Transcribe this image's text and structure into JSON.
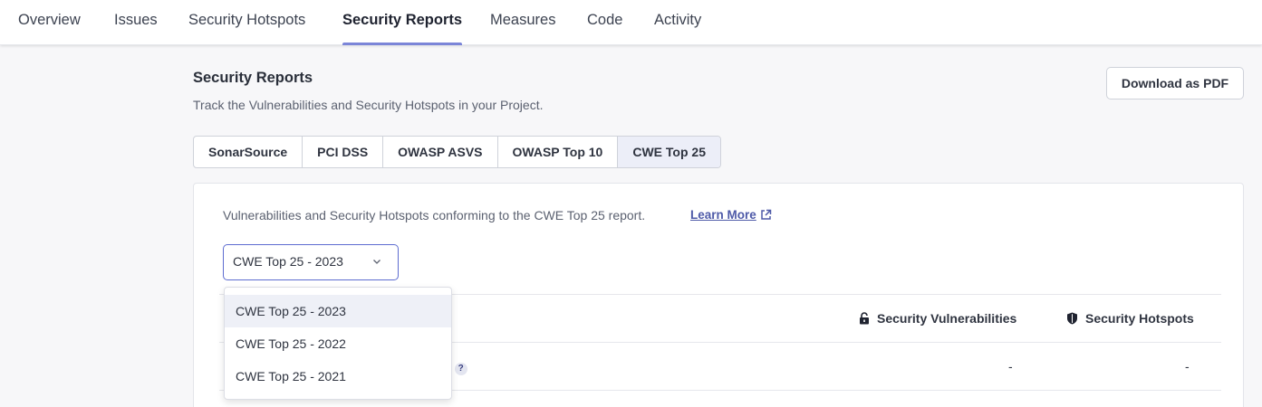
{
  "nav": {
    "tabs": [
      {
        "label": "Overview"
      },
      {
        "label": "Issues"
      },
      {
        "label": "Security Hotspots"
      },
      {
        "label": "Security Reports",
        "active": true
      },
      {
        "label": "Measures"
      },
      {
        "label": "Code"
      },
      {
        "label": "Activity"
      }
    ]
  },
  "header": {
    "title": "Security Reports",
    "description": "Track the Vulnerabilities and Security Hotspots in your Project.",
    "download_label": "Download as PDF"
  },
  "standards": {
    "tabs": [
      "SonarSource",
      "PCI DSS",
      "OWASP ASVS",
      "OWASP Top 10",
      "CWE Top 25"
    ],
    "active": "CWE Top 25"
  },
  "report": {
    "description": "Vulnerabilities and Security Hotspots conforming to the CWE Top 25 report.",
    "learn_more": "Learn More",
    "select": {
      "value": "CWE Top 25 - 2023",
      "options": [
        "CWE Top 25 - 2023",
        "CWE Top 25 - 2022",
        "CWE Top 25 - 2021"
      ]
    },
    "columns": {
      "vulnerabilities": "Security Vulnerabilities",
      "hotspots": "Security Hotspots"
    },
    "rows": [
      {
        "partial_label": "te",
        "help": "?",
        "vulnerabilities": "-",
        "hotspots": "-"
      }
    ]
  },
  "colors": {
    "accent": "#5d6cd0",
    "tab_underline": "#7b85d8",
    "link": "#4e5aa8"
  },
  "icons": [
    "lock-icon",
    "shield-icon",
    "external-link-icon",
    "chevron-down-icon"
  ]
}
